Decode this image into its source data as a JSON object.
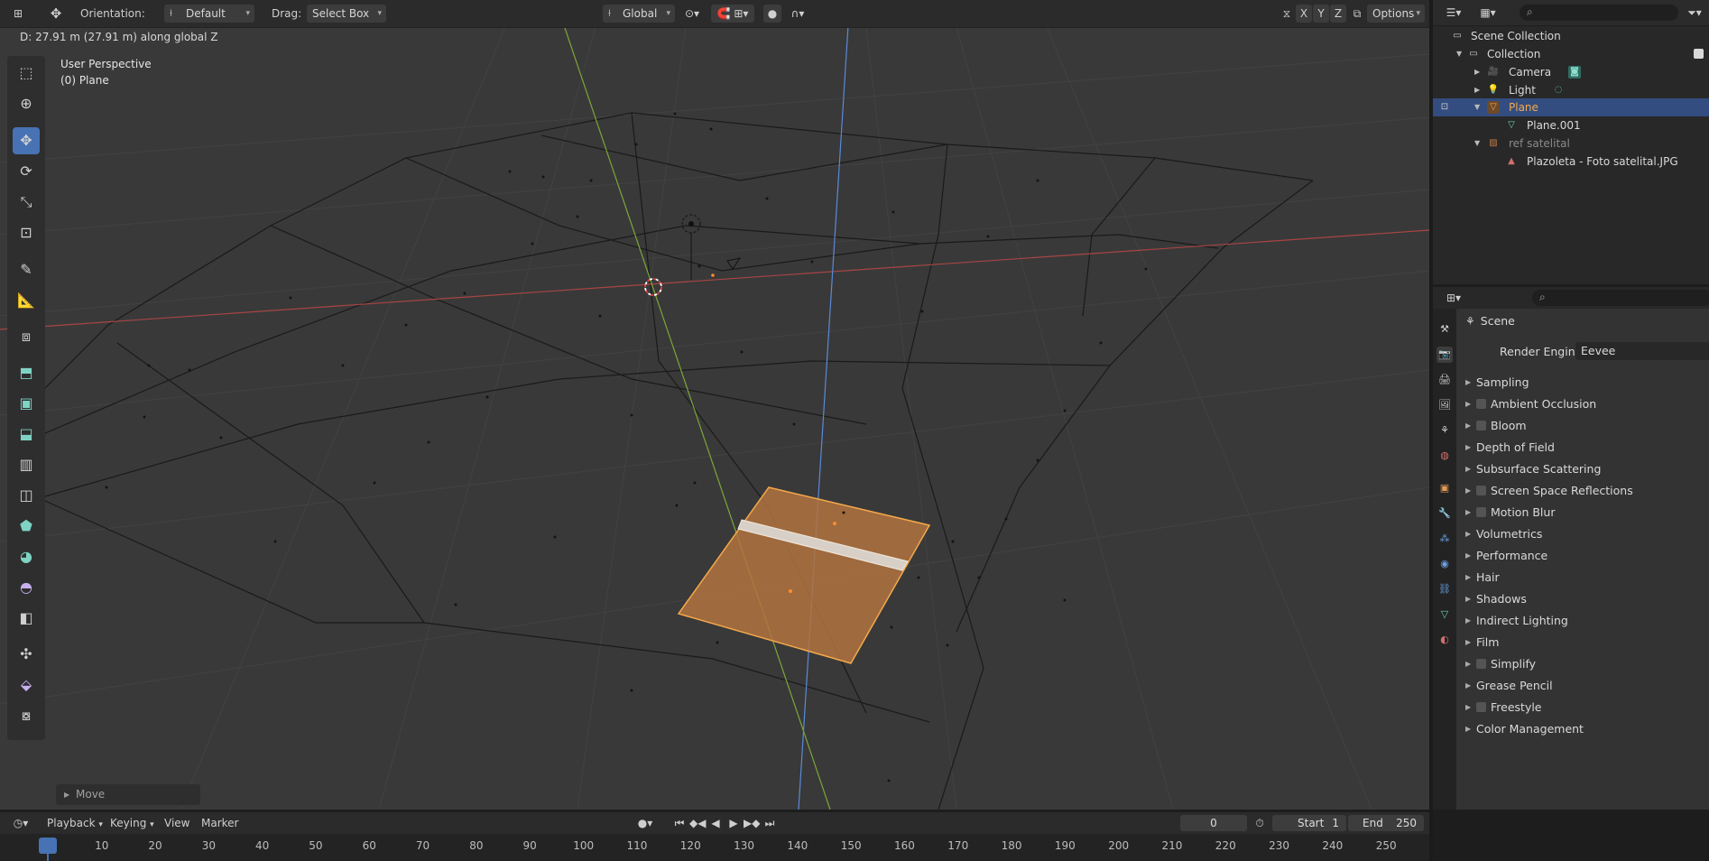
{
  "viewport_header": {
    "orientation_label": "Orientation:",
    "orientation_value": "Default",
    "drag_label": "Drag:",
    "drag_value": "Select Box",
    "transform_space": "Global",
    "axis_x": "X",
    "axis_y": "Y",
    "axis_z": "Z",
    "options_label": "Options"
  },
  "status_message": "D: 27.91 m (27.91 m) along global Z",
  "viewport_overlay": {
    "perspective": "User Perspective",
    "object": "(0) Plane"
  },
  "operator_panel": {
    "label": "Move"
  },
  "outliner": {
    "rows": [
      {
        "label": "Scene Collection"
      },
      {
        "label": "Collection"
      },
      {
        "label": "Camera"
      },
      {
        "label": "Light"
      },
      {
        "label": "Plane"
      },
      {
        "label": "Plane.001"
      },
      {
        "label": "ref satelital"
      },
      {
        "label": "Plazoleta - Foto satelital.JPG"
      }
    ]
  },
  "properties": {
    "context": "Scene",
    "render_engine_label": "Render Engine",
    "render_engine_value": "Eevee",
    "panels": [
      {
        "label": "Sampling",
        "checkbox": false
      },
      {
        "label": "Ambient Occlusion",
        "checkbox": true
      },
      {
        "label": "Bloom",
        "checkbox": true
      },
      {
        "label": "Depth of Field",
        "checkbox": false
      },
      {
        "label": "Subsurface Scattering",
        "checkbox": false
      },
      {
        "label": "Screen Space Reflections",
        "checkbox": true
      },
      {
        "label": "Motion Blur",
        "checkbox": true
      },
      {
        "label": "Volumetrics",
        "checkbox": false
      },
      {
        "label": "Performance",
        "checkbox": false
      },
      {
        "label": "Hair",
        "checkbox": false
      },
      {
        "label": "Shadows",
        "checkbox": false
      },
      {
        "label": "Indirect Lighting",
        "checkbox": false
      },
      {
        "label": "Film",
        "checkbox": false
      },
      {
        "label": "Simplify",
        "checkbox": true
      },
      {
        "label": "Grease Pencil",
        "checkbox": false
      },
      {
        "label": "Freestyle",
        "checkbox": true
      },
      {
        "label": "Color Management",
        "checkbox": false
      }
    ]
  },
  "timeline": {
    "playback_label": "Playback",
    "keying_label": "Keying",
    "view_label": "View",
    "marker_label": "Marker",
    "current_frame": "0",
    "start_label": "Start",
    "start_value": "1",
    "end_label": "End",
    "end_value": "250",
    "ruler_ticks": [
      "0",
      "10",
      "20",
      "30",
      "40",
      "50",
      "60",
      "70",
      "80",
      "90",
      "100",
      "110",
      "120",
      "130",
      "140",
      "150",
      "160",
      "170",
      "180",
      "190",
      "200",
      "210",
      "220",
      "230",
      "240",
      "250"
    ]
  },
  "colors": {
    "accent": "#4772b3",
    "selection": "#f5a94a",
    "x_axis": "#c24a4a",
    "y_axis": "#8ab33a",
    "z_axis": "#4a7bd0"
  }
}
